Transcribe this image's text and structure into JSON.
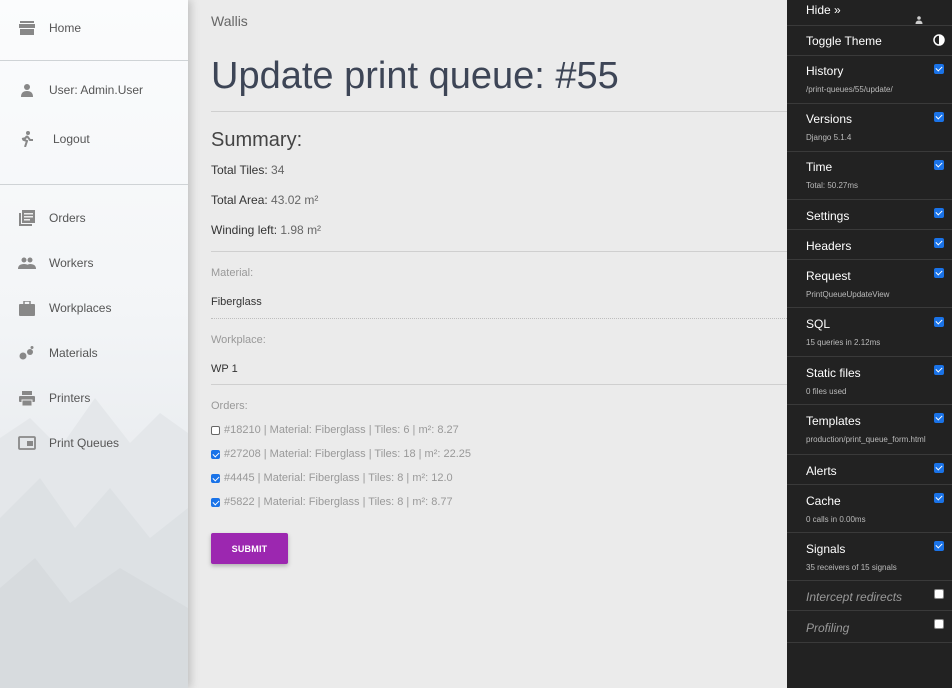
{
  "sidebar": {
    "items": [
      {
        "label": "Home",
        "icon": "store-icon"
      },
      {
        "label": "User: Admin.User",
        "icon": "person-icon"
      },
      {
        "label": "Logout",
        "icon": "running-person-icon"
      },
      {
        "label": "Orders",
        "icon": "list-icon"
      },
      {
        "label": "Workers",
        "icon": "people-icon"
      },
      {
        "label": "Workplaces",
        "icon": "briefcase-icon"
      },
      {
        "label": "Materials",
        "icon": "bubbles-icon"
      },
      {
        "label": "Printers",
        "icon": "printer-icon"
      },
      {
        "label": "Print Queues",
        "icon": "window-icon"
      }
    ]
  },
  "main": {
    "brand": "Wallis",
    "title": "Update print queue: #55",
    "summary": {
      "heading": "Summary:",
      "tiles_label": "Total Tiles:",
      "tiles_value": "34",
      "area_label": "Total Area:",
      "area_value": "43.02 m²",
      "winding_label": "Winding left:",
      "winding_value": "1.98 m²"
    },
    "material": {
      "label": "Material:",
      "value": "Fiberglass"
    },
    "workplace": {
      "label": "Workplace:",
      "value": "WP 1"
    },
    "orders": {
      "label": "Orders:",
      "items": [
        {
          "text": "#18210 | Material: Fiberglass | Tiles: 6 | m²: 8.27",
          "checked": false
        },
        {
          "text": "#27208 | Material: Fiberglass | Tiles: 18 | m²: 22.25",
          "checked": true
        },
        {
          "text": "#4445 | Material: Fiberglass | Tiles: 8 | m²: 12.0",
          "checked": true
        },
        {
          "text": "#5822 | Material: Fiberglass | Tiles: 8 | m²: 8.77",
          "checked": true
        }
      ]
    },
    "submit_label": "SUBMIT"
  },
  "debug_toolbar": {
    "hide_label": "Hide »",
    "toggle_theme_label": "Toggle Theme",
    "panels": [
      {
        "title": "History",
        "subtitle": "/print-queues/55/update/",
        "checked": true
      },
      {
        "title": "Versions",
        "subtitle": "Django 5.1.4",
        "checked": true
      },
      {
        "title": "Time",
        "subtitle": "Total: 50.27ms",
        "checked": true
      },
      {
        "title": "Settings",
        "subtitle": "",
        "checked": true
      },
      {
        "title": "Headers",
        "subtitle": "",
        "checked": true
      },
      {
        "title": "Request",
        "subtitle": "PrintQueueUpdateView",
        "checked": true
      },
      {
        "title": "SQL",
        "subtitle": "15 queries in 2.12ms",
        "checked": true
      },
      {
        "title": "Static files",
        "subtitle": "0 files used",
        "checked": true
      },
      {
        "title": "Templates",
        "subtitle": "production/print_queue_form.html",
        "checked": true
      },
      {
        "title": "Alerts",
        "subtitle": "",
        "checked": true
      },
      {
        "title": "Cache",
        "subtitle": "0 calls in 0.00ms",
        "checked": true
      },
      {
        "title": "Signals",
        "subtitle": "35 receivers of 15 signals",
        "checked": true
      },
      {
        "title": "Intercept redirects",
        "subtitle": "",
        "checked": false
      },
      {
        "title": "Profiling",
        "subtitle": "",
        "checked": false
      }
    ]
  },
  "colors": {
    "accent": "#9c27b0",
    "checkbox": "#1a73e8",
    "toolbar_bg": "#222222"
  }
}
